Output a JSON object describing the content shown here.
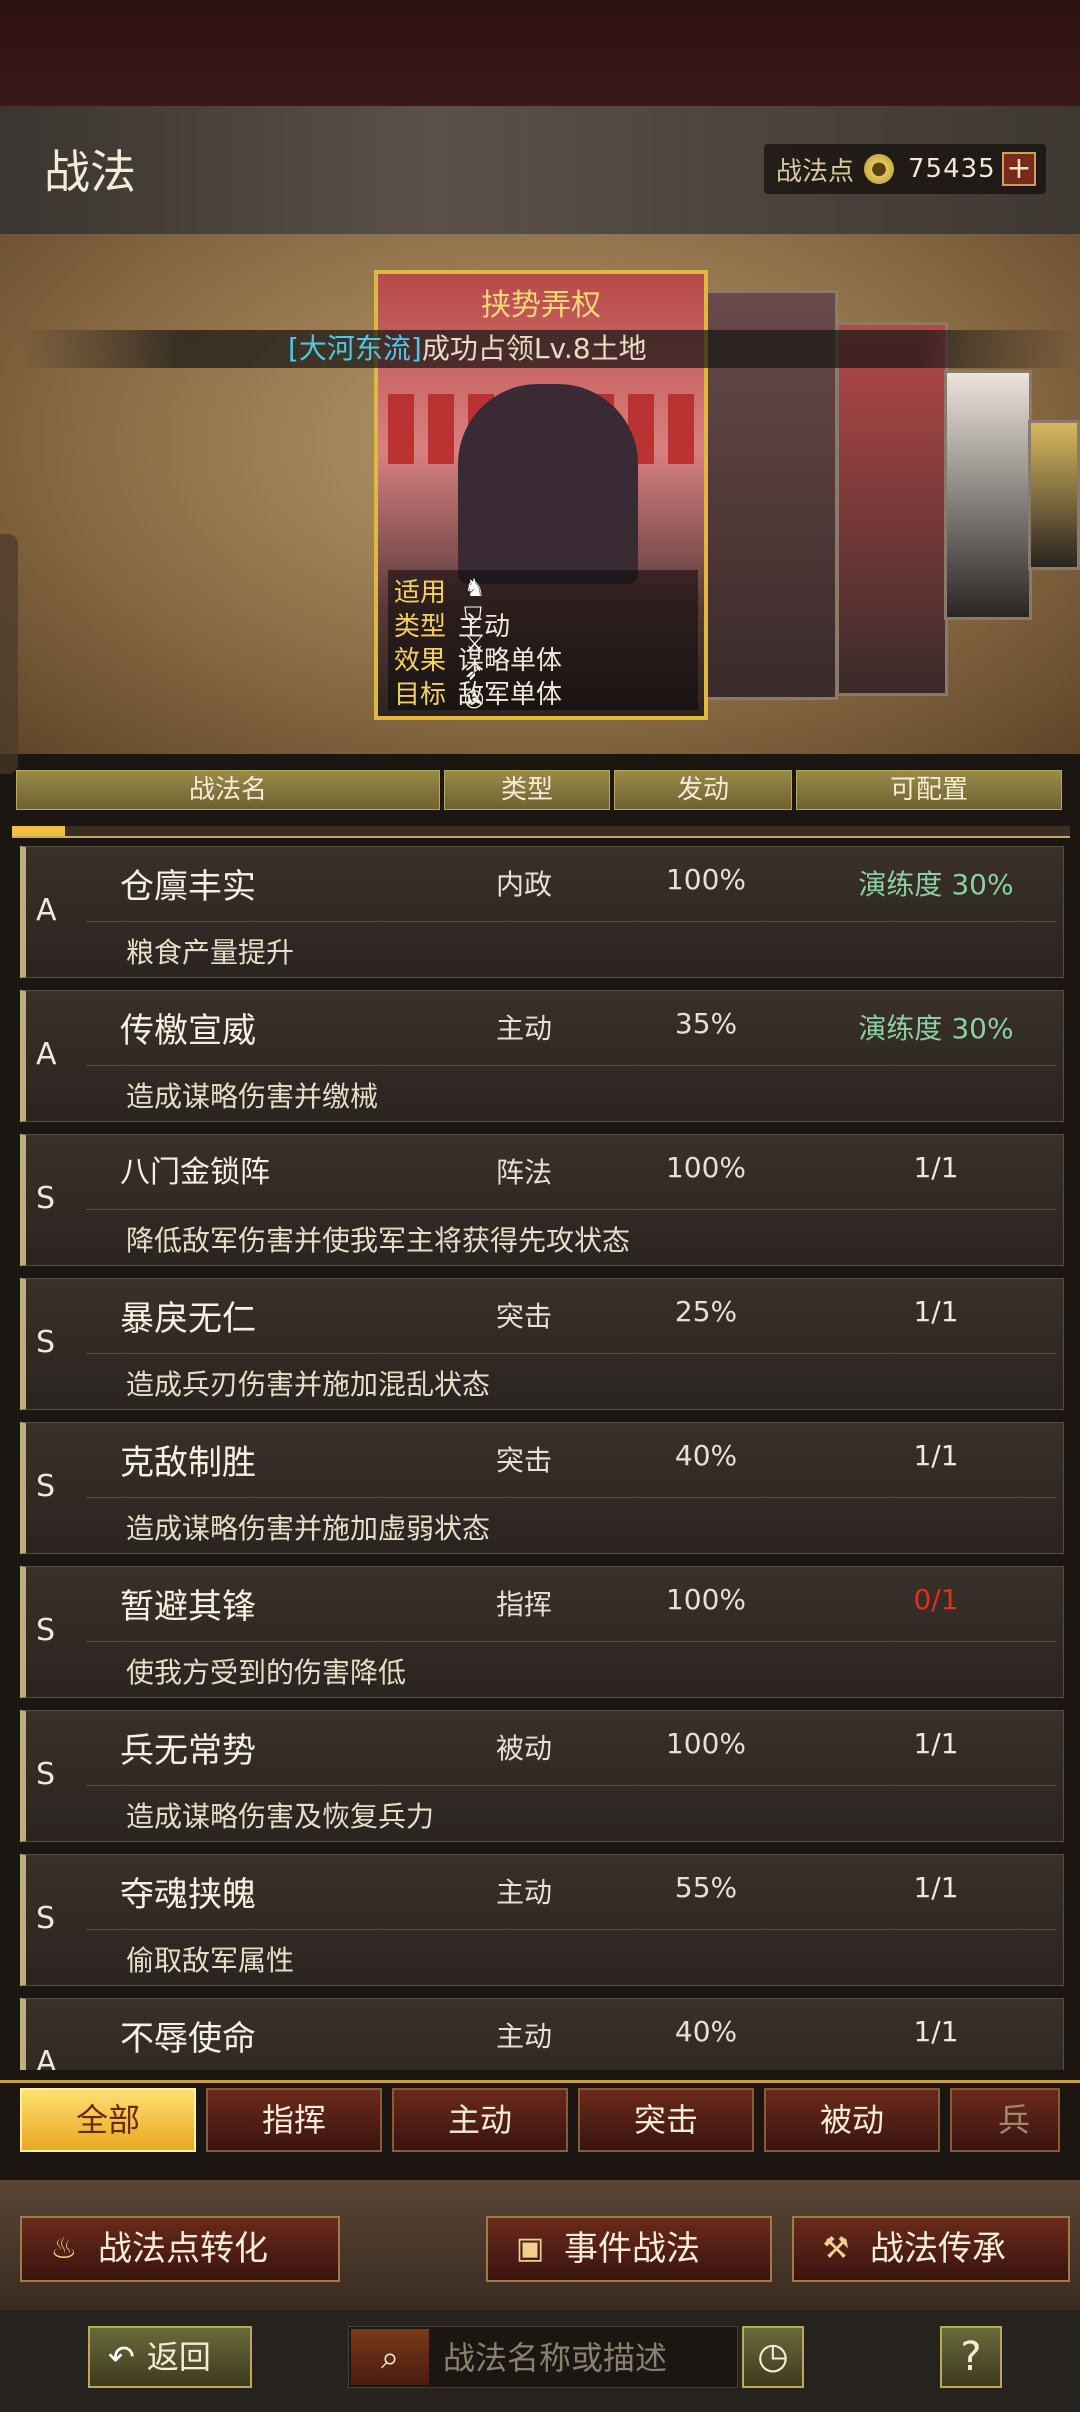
{
  "header": {
    "title": "战法",
    "points_label": "战法点",
    "points_value": "75435",
    "plus": "+"
  },
  "notice": {
    "highlight": "[大河东流]",
    "text": "成功占领Lv.8土地"
  },
  "card": {
    "name": "挟势弄权",
    "icons_label": "适用",
    "icons": "♞ ⛉ ⚔ ➶ ✇",
    "type_label": "类型",
    "type_value": "主动",
    "effect_label": "效果",
    "effect_value": "谋略单体",
    "target_label": "目标",
    "target_value": "敌军单体"
  },
  "columns": [
    "战法名",
    "类型",
    "发动",
    "可配置"
  ],
  "list_progress": 0.05,
  "skills": [
    {
      "grade": "A",
      "name": "仓廪丰实",
      "type": "内政",
      "rate": "100%",
      "avail": "演练度 30%",
      "desc": "粮食产量提升"
    },
    {
      "grade": "A",
      "name": "传檄宣威",
      "type": "主动",
      "rate": "35%",
      "avail": "演练度 30%",
      "desc": "造成谋略伤害并缴械"
    },
    {
      "grade": "S",
      "name": "八门金锁阵",
      "type": "阵法",
      "rate": "100%",
      "avail": "1/1",
      "desc": "降低敌军伤害并使我军主将获得先攻状态"
    },
    {
      "grade": "S",
      "name": "暴戾无仁",
      "type": "突击",
      "rate": "25%",
      "avail": "1/1",
      "desc": "造成兵刃伤害并施加混乱状态"
    },
    {
      "grade": "S",
      "name": "克敌制胜",
      "type": "突击",
      "rate": "40%",
      "avail": "1/1",
      "desc": "造成谋略伤害并施加虚弱状态"
    },
    {
      "grade": "S",
      "name": "暂避其锋",
      "type": "指挥",
      "rate": "100%",
      "avail": "0/1",
      "desc": "使我方受到的伤害降低"
    },
    {
      "grade": "S",
      "name": "兵无常势",
      "type": "被动",
      "rate": "100%",
      "avail": "1/1",
      "desc": "造成谋略伤害及恢复兵力"
    },
    {
      "grade": "S",
      "name": "夺魂挟魄",
      "type": "主动",
      "rate": "55%",
      "avail": "1/1",
      "desc": "偷取敌军属性"
    },
    {
      "grade": "A",
      "name": "不辱使命",
      "type": "主动",
      "rate": "40%",
      "avail": "1/1",
      "desc": ""
    }
  ],
  "colors": {
    "avail_green": "#8ad0a0",
    "avail_red": "#e03020",
    "active_tab": "#f0c040"
  },
  "tabs": [
    "全部",
    "指挥",
    "主动",
    "突击",
    "被动",
    "兵种"
  ],
  "actions": {
    "convert": "战法点转化",
    "event": "事件战法",
    "inherit": "战法传承"
  },
  "footer": {
    "back": "返回",
    "search_placeholder": "战法名称或描述",
    "help": "?"
  }
}
